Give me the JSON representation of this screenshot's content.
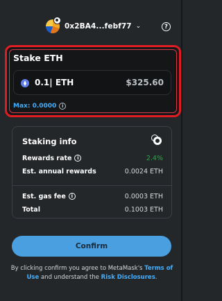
{
  "header": {
    "account_address": "0x2BA4...febf77",
    "chevron_icon": "chevron-down-icon",
    "help_icon": "?"
  },
  "stake": {
    "title": "Stake ETH",
    "amount_value": "0.1| ETH",
    "amount_fiat": "$325.60",
    "max_label": "Max: 0.0000",
    "info_icon": "i"
  },
  "staking_info": {
    "title": "Staking info",
    "rows_top": [
      {
        "label": "Rewards rate",
        "value": "2.4%",
        "has_info": true,
        "color": "#28a745"
      },
      {
        "label": "Est. annual rewards",
        "value": "0.0024 ETH",
        "has_info": false
      }
    ],
    "rows_bottom": [
      {
        "label": "Est. gas fee",
        "value": "0.0003 ETH",
        "has_info": true
      },
      {
        "label": "Total",
        "value": "0.1003 ETH",
        "has_info": false
      }
    ]
  },
  "confirm_label": "Confirm",
  "disclaimer": {
    "prefix": "By clicking confirm you agree to MetaMask's ",
    "terms_link": "Terms of Use",
    "middle": " and understand the ",
    "risk_link": "Risk Disclosures",
    "suffix": "."
  },
  "colors": {
    "accent_blue": "#43aefc",
    "button_blue": "#4a9fe1",
    "highlight_red": "#e11d24",
    "success_green": "#28a745",
    "background": "#24272a"
  }
}
